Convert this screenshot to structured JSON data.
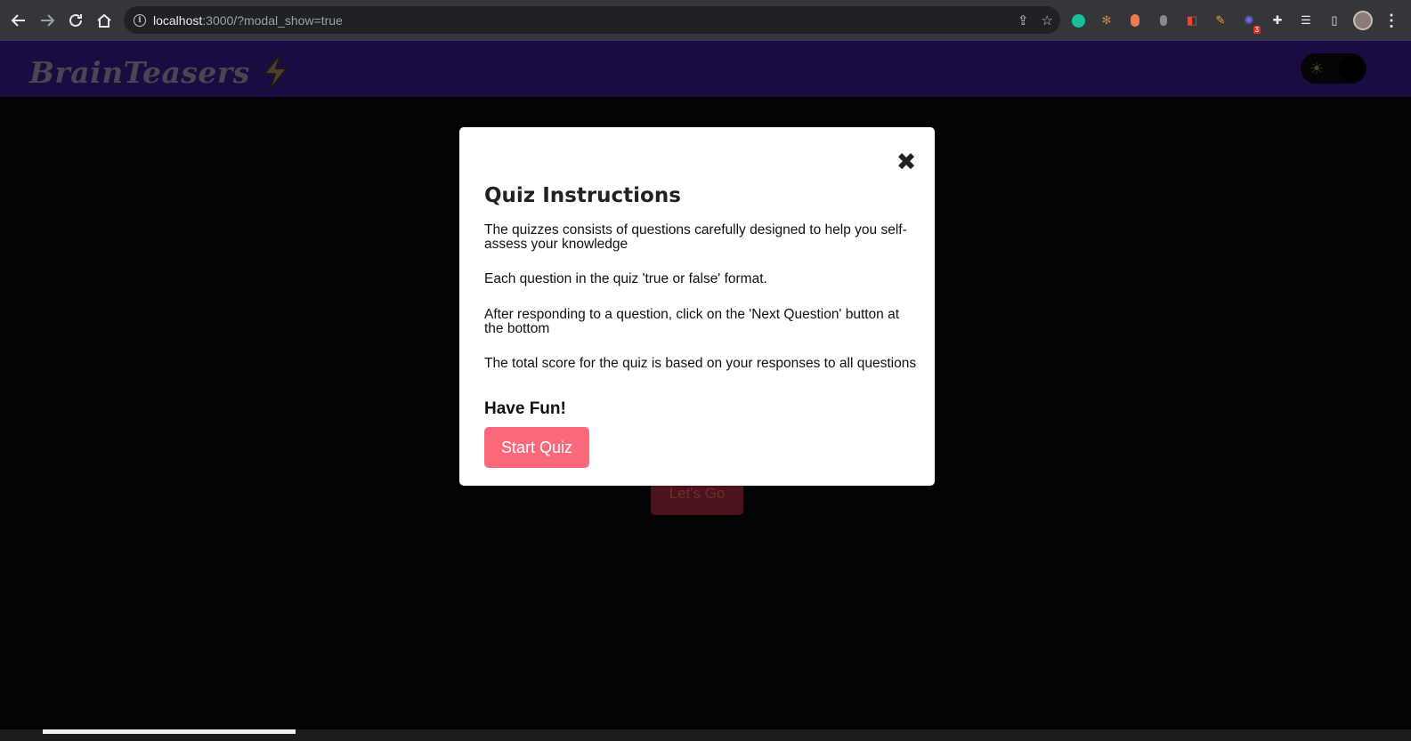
{
  "browser": {
    "url_host": "localhost",
    "url_rest": ":3000/?modal_show=true",
    "extensions": [
      "grammarly-icon",
      "extension-icon",
      "extension-icon",
      "extension-icon",
      "extension-icon",
      "pen-icon",
      "extension-icon",
      "puzzle-icon",
      "reading-list-icon",
      "sidepanel-icon"
    ],
    "badge_count": "3"
  },
  "header": {
    "brand": "BrainTeasers",
    "brand_color": "#4c4451",
    "background": "#1a0b40"
  },
  "page": {
    "lets_go_label": "Let's Go"
  },
  "modal": {
    "close_label": "✖",
    "title": "Quiz Instructions",
    "paragraphs": [
      "The quizzes consists of questions carefully designed to help you self-assess your knowledge",
      "Each question in the quiz 'true or false' format.",
      "After responding to a question, click on the 'Next Question' button at the bottom",
      "The total score for the quiz is based on your responses to all questions"
    ],
    "closing": "Have Fun!",
    "start_label": "Start Quiz",
    "start_color": "#fa6a7c"
  }
}
